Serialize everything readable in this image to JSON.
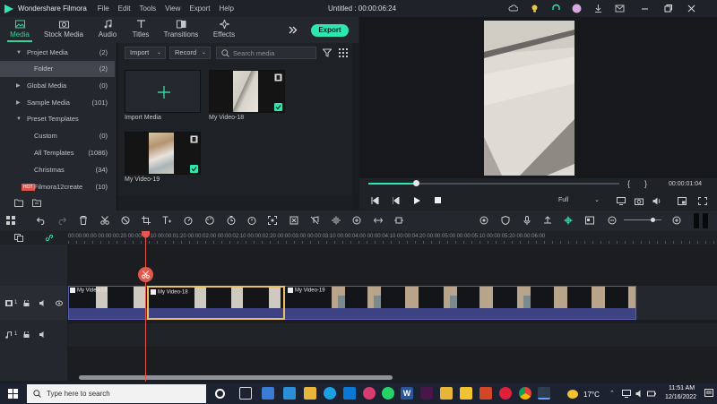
{
  "app": {
    "name": "Wondershare Filmora",
    "document_title": "Untitled : 00:00:06:24"
  },
  "menu": [
    "File",
    "Edit",
    "Tools",
    "View",
    "Export",
    "Help"
  ],
  "tabs": [
    {
      "label": "Media",
      "active": true
    },
    {
      "label": "Stock Media"
    },
    {
      "label": "Audio"
    },
    {
      "label": "Titles"
    },
    {
      "label": "Transitions"
    },
    {
      "label": "Effects"
    }
  ],
  "export_label": "Export",
  "library": [
    {
      "label": "Project Media",
      "count": "(2)",
      "arrow": "▼"
    },
    {
      "label": "Folder",
      "count": "(2)",
      "selected": true
    },
    {
      "label": "Global Media",
      "count": "(0)",
      "arrow": "▶"
    },
    {
      "label": "Sample Media",
      "count": "(101)",
      "arrow": "▶"
    },
    {
      "label": "Preset Templates",
      "count": "",
      "arrow": "▼"
    },
    {
      "label": "Custom",
      "count": "(0)"
    },
    {
      "label": "All Templates",
      "count": "(1086)"
    },
    {
      "label": "Christmas",
      "count": "(34)"
    },
    {
      "label": "Filmora12create",
      "count": "(10)",
      "badge": "HOT"
    }
  ],
  "media_toolbar": {
    "import_label": "Import",
    "record_label": "Record",
    "search_placeholder": "Search media"
  },
  "media_items": [
    {
      "caption": "Import Media"
    },
    {
      "caption": "My Video-18"
    },
    {
      "caption": "My Video-19"
    }
  ],
  "preview": {
    "timecode": "00:00:01:04",
    "quality": "Full",
    "progress": 0.19
  },
  "timeline": {
    "ruler_labels": "00:00:00:00 00:00:00:20 00:00:01:10 00:00:01:20 00:00:02:00 00:00:02:10 00:00:02:20 00:00:03:00 00:00:03:10 00:00:04:00 00:00:04:10 00:00:04:20 00:00:05:00 00:00:05:10 00:00:05:20 00:00:06:00",
    "clips": [
      {
        "label": "My Video-18"
      },
      {
        "label": "My Video-18"
      },
      {
        "label": "My Video-19"
      }
    ],
    "video_track": "1",
    "audio_track": "1"
  },
  "taskbar": {
    "search_placeholder": "Type here to search",
    "temperature": "17°C",
    "time": "11:51 AM",
    "date": "12/16/2022"
  }
}
